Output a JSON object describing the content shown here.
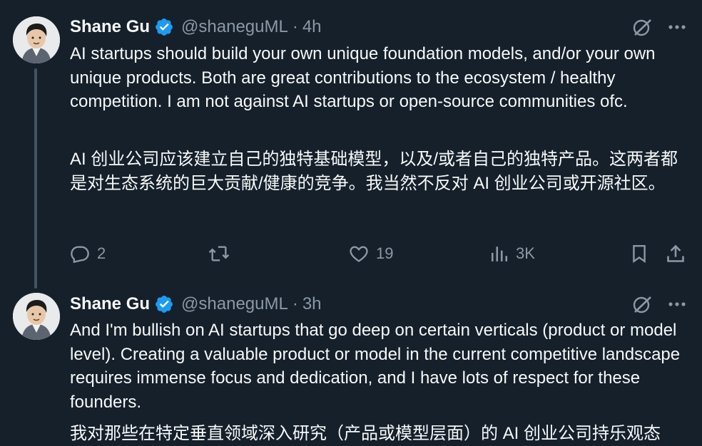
{
  "tweets": [
    {
      "author": "Shane Gu",
      "handle": "@shaneguML",
      "separator": "·",
      "time": "4h",
      "paragraphs": [
        "AI startups should build your own unique foundation models, and/or your own unique products. Both are great contributions to the ecosystem / healthy competition. I am not against AI startups or open-source communities ofc.",
        "AI 创业公司应该建立自己的独特基础模型，以及/或者自己的独特产品。这两者都是对生态系统的巨大贡献/健康的竞争。我当然不反对 AI 创业公司或开源社区。"
      ],
      "stats": {
        "replies": "2",
        "retweets": "",
        "likes": "19",
        "views": "3K"
      }
    },
    {
      "author": "Shane Gu",
      "handle": "@shaneguML",
      "separator": "·",
      "time": "3h",
      "paragraphs": [
        "And I'm bullish on AI startups that go deep on certain verticals (product or model level). Creating a valuable product or model in the current competitive landscape requires immense focus and dedication, and I have lots of respect for these founders.",
        "我对那些在特定垂直领域深入研究（产品或模型层面）的 AI 创业公司持乐观态"
      ]
    }
  ],
  "icons": {
    "verified": "verified-badge-icon",
    "grok": "grok-icon",
    "more": "more-icon",
    "reply": "reply-icon",
    "retweet": "retweet-icon",
    "like": "like-icon",
    "views": "views-icon",
    "bookmark": "bookmark-icon",
    "share": "share-icon"
  },
  "colors": {
    "background": "#15202b",
    "text": "#f7f9f9",
    "muted": "#8b98a5",
    "verified": "#1d9bf0",
    "thread_line": "#425364"
  }
}
